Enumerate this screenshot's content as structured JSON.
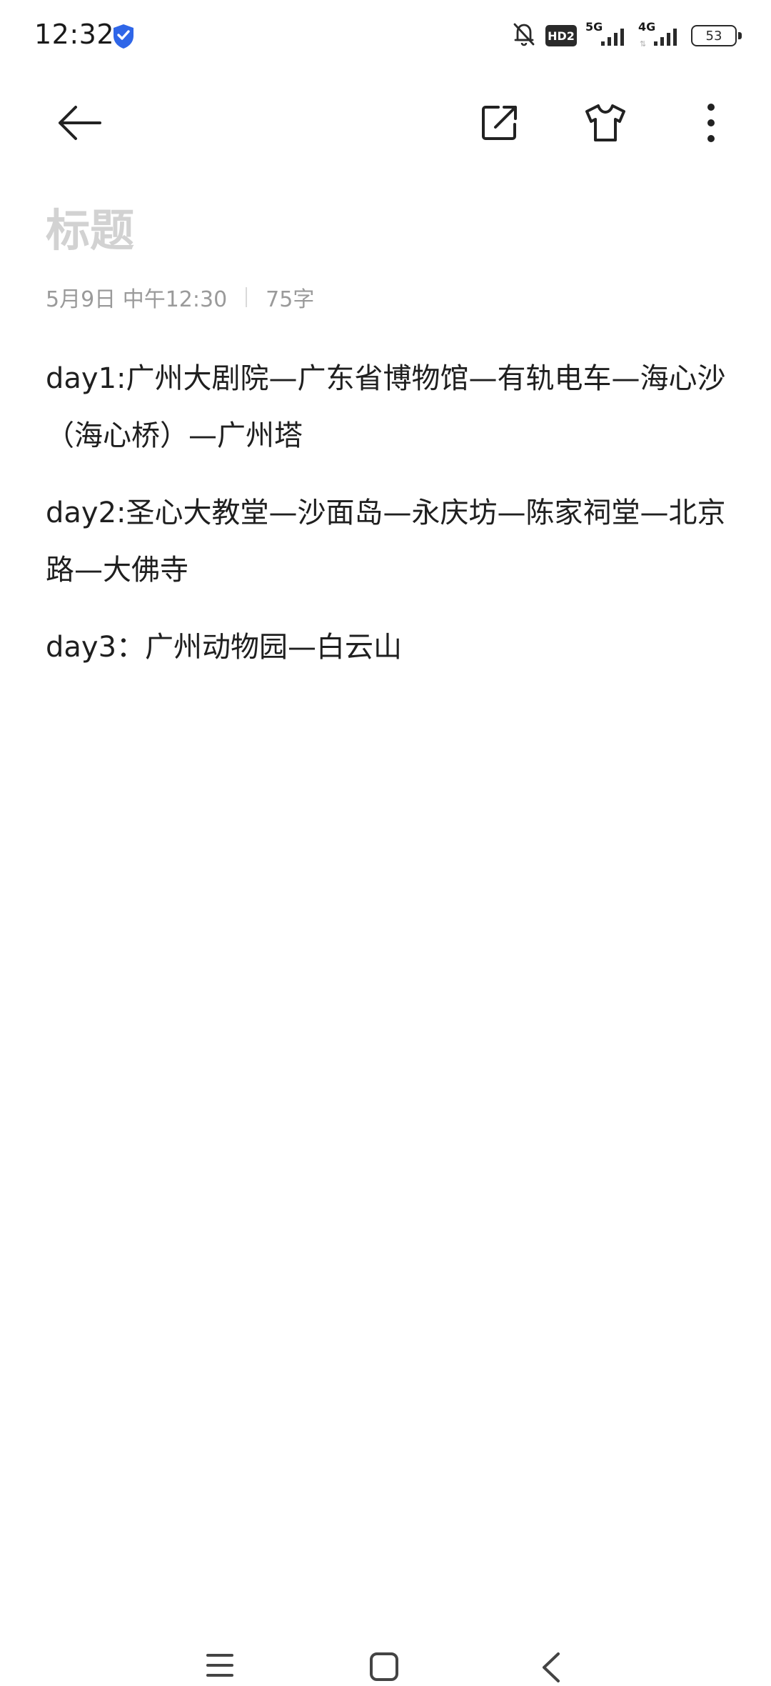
{
  "status_bar": {
    "time": "12:32",
    "hd_label": "HD2",
    "net_5g": "5G",
    "net_4g": "4G",
    "battery": "53"
  },
  "icons": {
    "security": "shield-icon",
    "mute": "bell-off-icon",
    "back": "arrow-left-icon",
    "share": "external-link-icon",
    "theme": "tshirt-icon",
    "more": "dots-vertical-icon",
    "nav_menu": "menu-lines-icon",
    "nav_home": "square-icon",
    "nav_back": "chevron-left-icon"
  },
  "colors": {
    "accent_shield": "#2f66e8",
    "title_placeholder": "#d2d2d2",
    "meta_text": "#9a9a9a"
  },
  "note": {
    "title_placeholder": "标题",
    "date": "5月9日 中午12:30",
    "word_count": "75字",
    "lines": [
      "day1:广州大剧院—广东省博物馆—有轨电车—海心沙（海心桥）—广州塔",
      "day2:圣心大教堂—沙面岛—永庆坊—陈家祠堂—北京路—大佛寺",
      "day3：广州动物园—白云山"
    ]
  }
}
